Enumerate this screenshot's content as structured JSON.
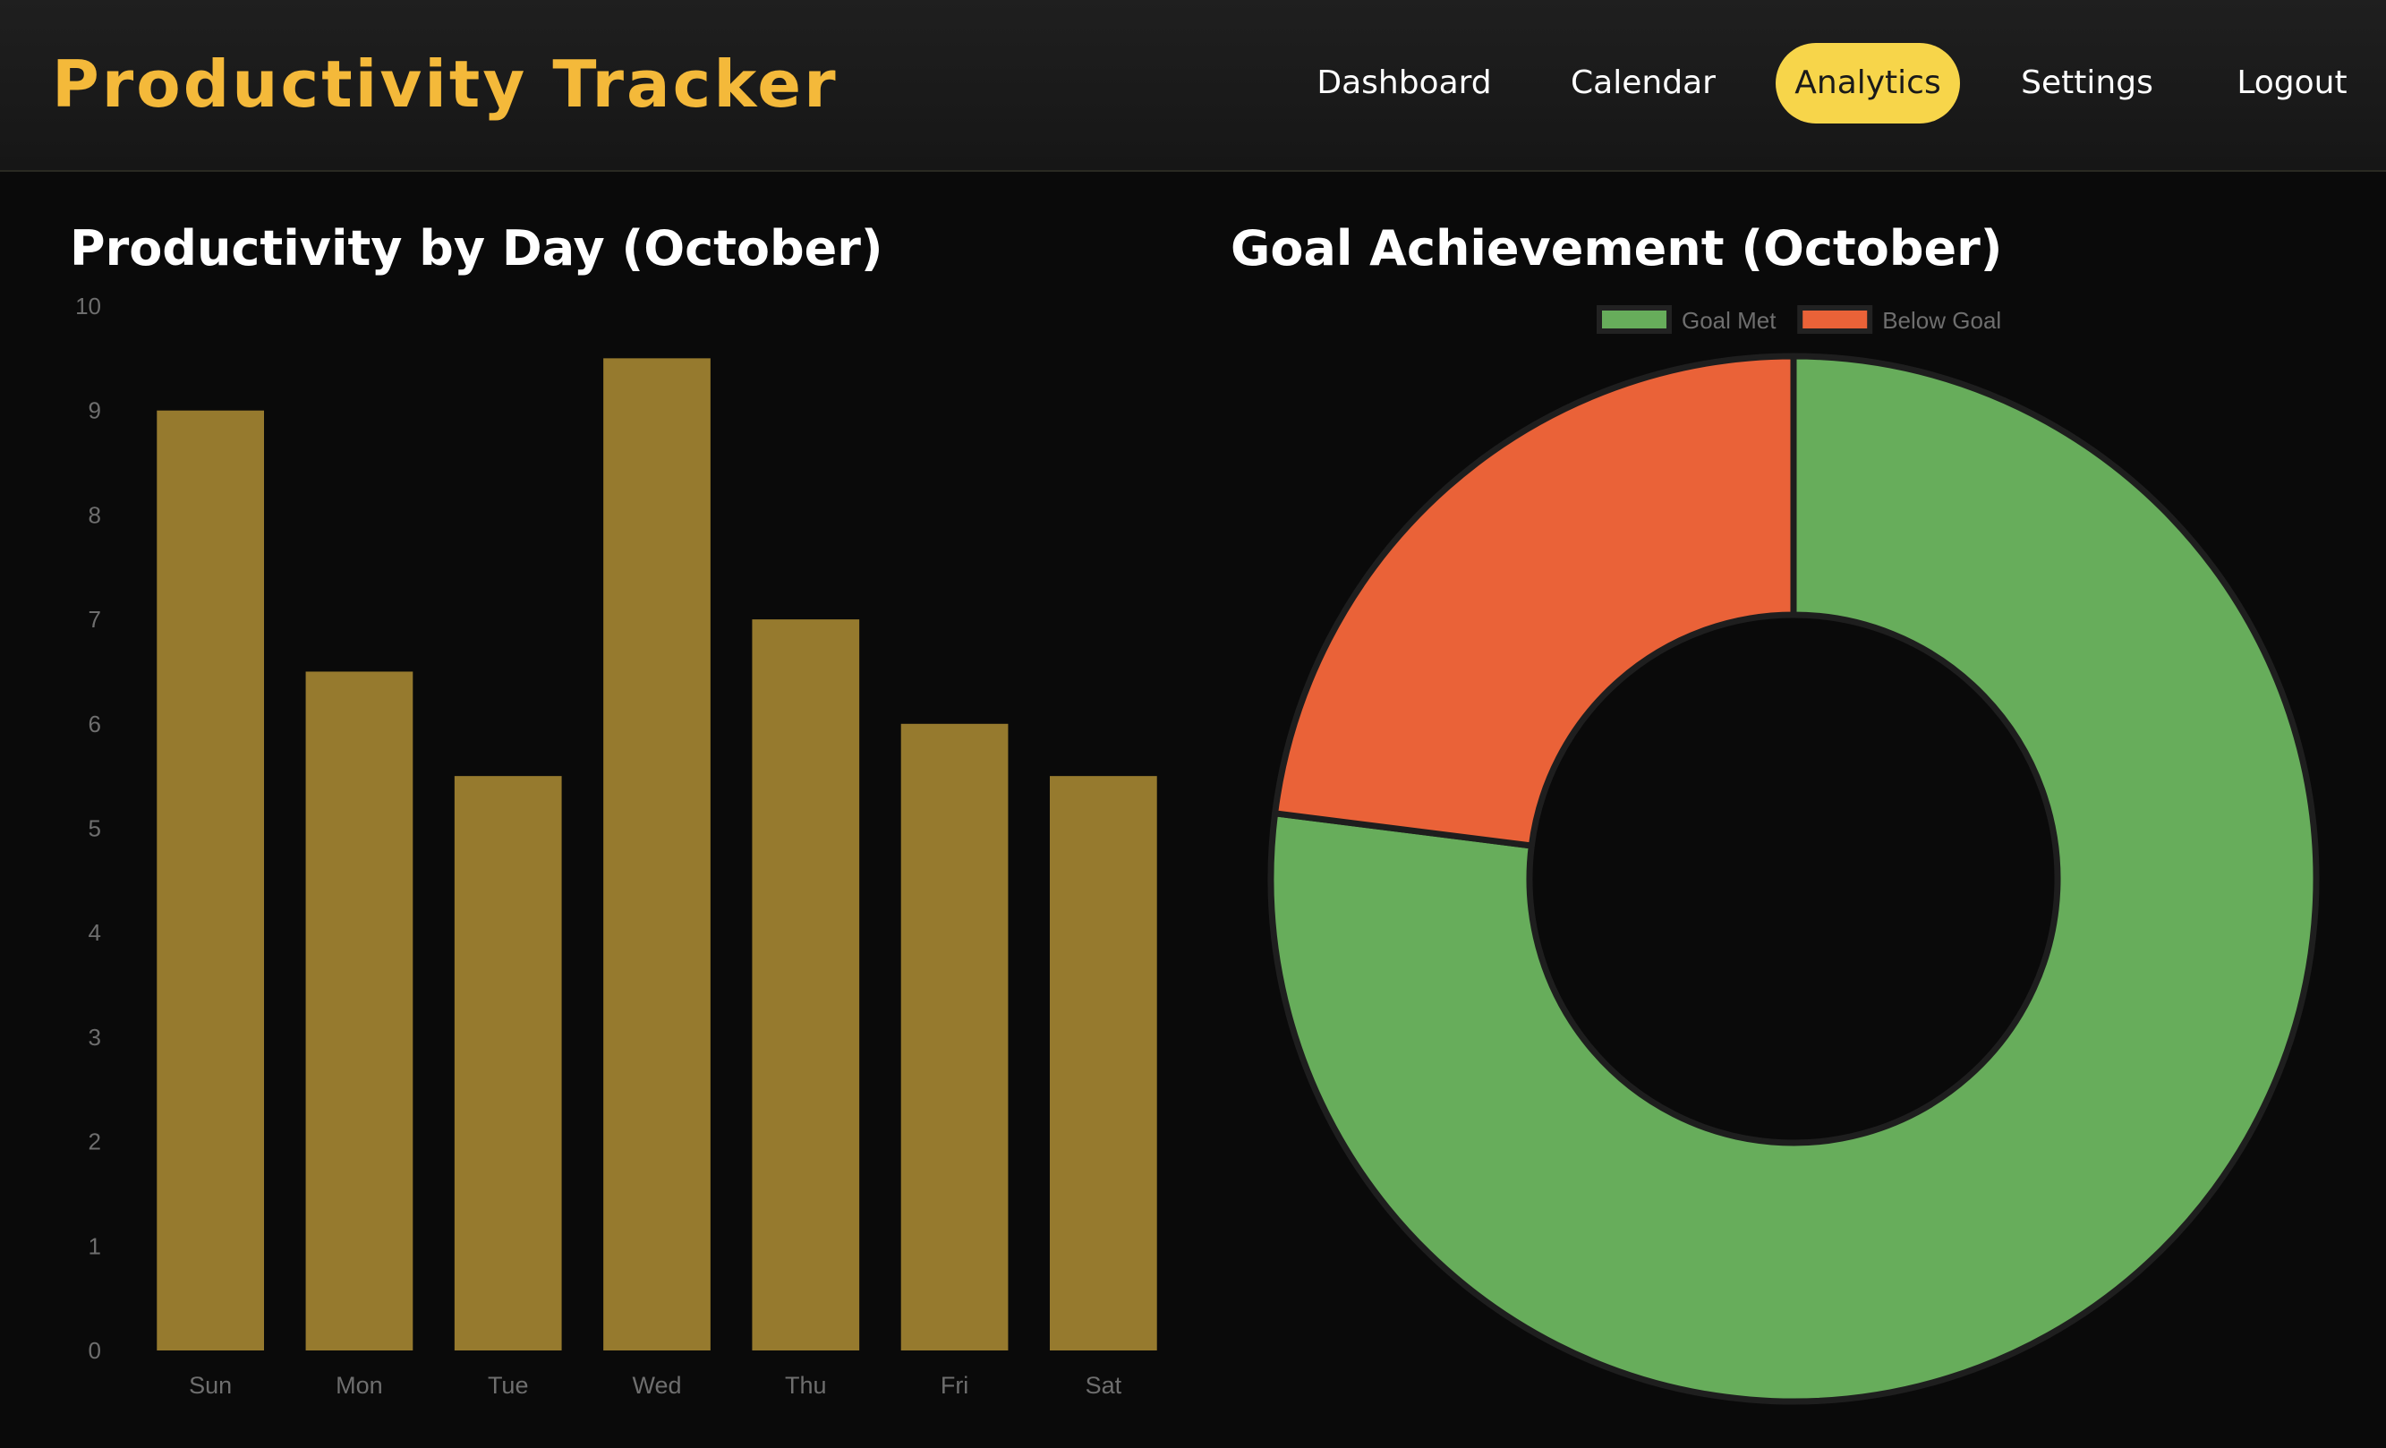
{
  "header": {
    "app_title": "Productivity Tracker",
    "nav": [
      {
        "label": "Dashboard",
        "active": false
      },
      {
        "label": "Calendar",
        "active": false
      },
      {
        "label": "Analytics",
        "active": true
      },
      {
        "label": "Settings",
        "active": false
      },
      {
        "label": "Logout",
        "active": false
      }
    ],
    "accent_color": "#f4b93a",
    "active_nav_color": "#f7d54a"
  },
  "charts": {
    "bar_title": "Productivity by Day (October)",
    "donut_title": "Goal Achievement (October)"
  },
  "chart_data": [
    {
      "type": "bar",
      "title": "Productivity by Day (October)",
      "categories": [
        "Sun",
        "Mon",
        "Tue",
        "Wed",
        "Thu",
        "Fri",
        "Sat"
      ],
      "values": [
        9,
        6.5,
        5.5,
        9.5,
        7,
        6,
        5.5
      ],
      "ylim": [
        0,
        10
      ],
      "yticks": [
        0,
        1,
        2,
        3,
        4,
        5,
        6,
        7,
        8,
        9,
        10
      ],
      "xlabel": "",
      "ylabel": "",
      "grid": false,
      "color": "#967a2e"
    },
    {
      "type": "pie",
      "title": "Goal Achievement (October)",
      "donut": true,
      "labels": [
        "Goal Met",
        "Below Goal"
      ],
      "values": [
        77,
        23
      ],
      "colors": [
        "#67ad5b",
        "#ea6238"
      ],
      "legend": "top-center"
    }
  ]
}
